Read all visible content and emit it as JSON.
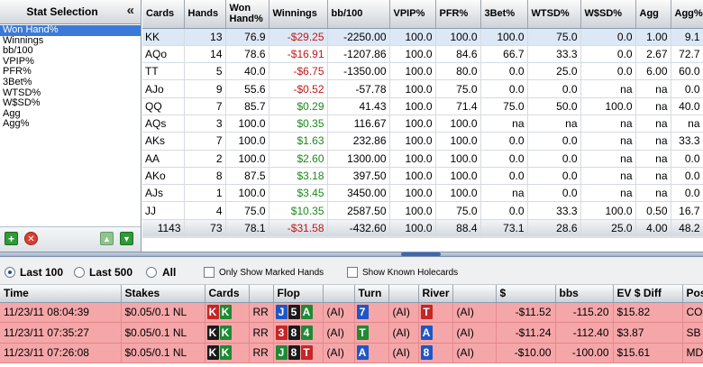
{
  "sidebar": {
    "title": "Stat Selection",
    "collapse_glyph": "«",
    "stats": [
      "Won Hand%",
      "Winnings",
      "bb/100",
      "VPIP%",
      "PFR%",
      "3Bet%",
      "WTSD%",
      "W$SD%",
      "Agg",
      "Agg%"
    ],
    "selected_index": 0,
    "toolbar": {
      "add": "+",
      "remove": "✕",
      "up": "▲",
      "down": "▼"
    }
  },
  "stats_table": {
    "columns": [
      "Cards",
      "Hands",
      "Won Hand%",
      "Winnings",
      "bb/100",
      "VPIP%",
      "PFR%",
      "3Bet%",
      "WTSD%",
      "W$SD%",
      "Agg",
      "Agg%"
    ],
    "rows": [
      [
        "KK",
        "13",
        "76.9",
        "-$29.25",
        "-2250.00",
        "100.0",
        "100.0",
        "100.0",
        "75.0",
        "0.0",
        "1.00",
        "9.1"
      ],
      [
        "AQo",
        "14",
        "78.6",
        "-$16.91",
        "-1207.86",
        "100.0",
        "84.6",
        "66.7",
        "33.3",
        "0.0",
        "2.67",
        "72.7"
      ],
      [
        "TT",
        "5",
        "40.0",
        "-$6.75",
        "-1350.00",
        "100.0",
        "80.0",
        "0.0",
        "25.0",
        "0.0",
        "6.00",
        "60.0"
      ],
      [
        "AJo",
        "9",
        "55.6",
        "-$0.52",
        "-57.78",
        "100.0",
        "75.0",
        "0.0",
        "0.0",
        "na",
        "na",
        "0.0"
      ],
      [
        "QQ",
        "7",
        "85.7",
        "$0.29",
        "41.43",
        "100.0",
        "71.4",
        "75.0",
        "50.0",
        "100.0",
        "na",
        "40.0"
      ],
      [
        "AQs",
        "3",
        "100.0",
        "$0.35",
        "116.67",
        "100.0",
        "100.0",
        "na",
        "na",
        "na",
        "na",
        "na"
      ],
      [
        "AKs",
        "7",
        "100.0",
        "$1.63",
        "232.86",
        "100.0",
        "100.0",
        "0.0",
        "0.0",
        "na",
        "na",
        "33.3"
      ],
      [
        "AA",
        "2",
        "100.0",
        "$2.60",
        "1300.00",
        "100.0",
        "100.0",
        "0.0",
        "0.0",
        "na",
        "na",
        "0.0"
      ],
      [
        "AKo",
        "8",
        "87.5",
        "$3.18",
        "397.50",
        "100.0",
        "100.0",
        "0.0",
        "0.0",
        "na",
        "na",
        "0.0"
      ],
      [
        "AJs",
        "1",
        "100.0",
        "$3.45",
        "3450.00",
        "100.0",
        "100.0",
        "na",
        "0.0",
        "na",
        "na",
        "0.0"
      ],
      [
        "JJ",
        "4",
        "75.0",
        "$10.35",
        "2587.50",
        "100.0",
        "75.0",
        "0.0",
        "33.3",
        "100.0",
        "0.50",
        "16.7"
      ]
    ],
    "totals": [
      "1143",
      "73",
      "78.1",
      "-$31.58",
      "-432.60",
      "100.0",
      "88.4",
      "73.1",
      "28.6",
      "25.0",
      "4.00",
      "48.2"
    ],
    "selected_row": 0
  },
  "filters": {
    "radios": [
      {
        "label": "Last 100",
        "checked": true
      },
      {
        "label": "Last 500",
        "checked": false
      },
      {
        "label": "All",
        "checked": false
      }
    ],
    "checkboxes": [
      {
        "label": "Only Show Marked Hands",
        "checked": false
      },
      {
        "label": "Show Known Holecards",
        "checked": false
      }
    ]
  },
  "hands_table": {
    "columns": [
      "Time",
      "Stakes",
      "Cards",
      "",
      "Flop",
      "",
      "Turn",
      "",
      "River",
      "",
      "$",
      "bbs",
      "EV $ Diff",
      "Pos"
    ],
    "rows": [
      {
        "time": "11/23/11 08:04:39",
        "stakes": "$0.05/0.1 NL",
        "cards": [
          {
            "r": "K",
            "s": "h"
          },
          {
            "r": "K",
            "s": "c"
          }
        ],
        "pre": "RR",
        "flop": [
          {
            "r": "J",
            "s": "d"
          },
          {
            "r": "5",
            "s": "s"
          },
          {
            "r": "A",
            "s": "c"
          }
        ],
        "flop_act": "(AI)",
        "turn": [
          {
            "r": "7",
            "s": "d"
          }
        ],
        "turn_act": "(AI)",
        "river": [
          {
            "r": "T",
            "s": "h"
          }
        ],
        "river_act": "(AI)",
        "amount": "-$11.52",
        "bbs": "-115.20",
        "ev_diff": "$15.82",
        "pos": "CO"
      },
      {
        "time": "11/23/11 07:35:27",
        "stakes": "$0.05/0.1 NL",
        "cards": [
          {
            "r": "K",
            "s": "s"
          },
          {
            "r": "K",
            "s": "c"
          }
        ],
        "pre": "RR",
        "flop": [
          {
            "r": "3",
            "s": "h"
          },
          {
            "r": "8",
            "s": "s"
          },
          {
            "r": "4",
            "s": "c"
          }
        ],
        "flop_act": "(AI)",
        "turn": [
          {
            "r": "T",
            "s": "c"
          }
        ],
        "turn_act": "(AI)",
        "river": [
          {
            "r": "A",
            "s": "d"
          }
        ],
        "river_act": "(AI)",
        "amount": "-$11.24",
        "bbs": "-112.40",
        "ev_diff": "$3.87",
        "pos": "SB"
      },
      {
        "time": "11/23/11 07:26:08",
        "stakes": "$0.05/0.1 NL",
        "cards": [
          {
            "r": "K",
            "s": "s"
          },
          {
            "r": "K",
            "s": "c"
          }
        ],
        "pre": "RR",
        "flop": [
          {
            "r": "J",
            "s": "c"
          },
          {
            "r": "8",
            "s": "s"
          },
          {
            "r": "T",
            "s": "h"
          }
        ],
        "flop_act": "(AI)",
        "turn": [
          {
            "r": "A",
            "s": "d"
          }
        ],
        "turn_act": "(AI)",
        "river": [
          {
            "r": "8",
            "s": "d"
          }
        ],
        "river_act": "(AI)",
        "amount": "-$10.00",
        "bbs": "-100.00",
        "ev_diff": "$15.61",
        "pos": "MD"
      }
    ]
  },
  "colors": {
    "negative": "#c01818",
    "positive": "#1c8a1c",
    "selected_stat": "#3b7ad8",
    "hand_row": "#f5a6a8",
    "suit_spade": "#1a1a1a",
    "suit_heart": "#c52626",
    "suit_diamond": "#1f56c4",
    "suit_club": "#1f8a34"
  }
}
